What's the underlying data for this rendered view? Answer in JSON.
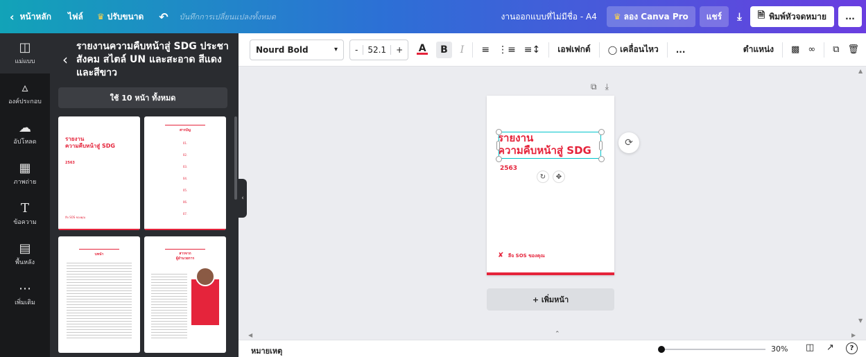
{
  "topbar": {
    "home_label": "หน้าหลัก",
    "file_label": "ไฟล์",
    "resize_label": "ปรับขนาด",
    "undo_icon": "undo-icon",
    "save_status": "บันทึกการเปลี่ยนแปลงทั้งหมด",
    "doc_title": "งานออกแบบที่ไม่มีชื่อ - A4",
    "pro_label": "ลอง Canva Pro",
    "share_label": "แชร์",
    "print_label": "พิมพ์หัวจดหมาย",
    "more_label": "..."
  },
  "rail": {
    "items": [
      {
        "label": "แม่แบบ",
        "icon": "template-icon"
      },
      {
        "label": "องค์ประกอบ",
        "icon": "elements-icon"
      },
      {
        "label": "อัปโหลด",
        "icon": "upload-icon"
      },
      {
        "label": "ภาพถ่าย",
        "icon": "photos-icon"
      },
      {
        "label": "ข้อความ",
        "icon": "text-icon"
      },
      {
        "label": "พื้นหลัง",
        "icon": "background-icon"
      },
      {
        "label": "เพิ่มเติม",
        "icon": "more-icon"
      }
    ]
  },
  "panel": {
    "title": "รายงานความคืบหน้าสู่ SDG ประชาสังคม สไตล์ UN และสะอาด สีแดงและสีขาว",
    "use_all_label": "ใช้ 10 หน้า ทั้งหมด",
    "thumb1": {
      "line1": "รายงาน",
      "line2": "ความคืบหน้าสู่ SDG",
      "year": "2563",
      "foot": "ลีจ SOS ของคุณ"
    },
    "thumb2": {
      "heading": "สารบัญ",
      "entries": [
        "01.",
        "02.",
        "03.",
        "04.",
        "05.",
        "06.",
        "07."
      ]
    },
    "thumb3": {
      "heading": "บทนำ"
    },
    "thumb4": {
      "heading": "สารจาก",
      "subheading": "ผู้อำนวยการ"
    }
  },
  "toolbar": {
    "font": "Nourd Bold",
    "size": "52.1",
    "minus": "-",
    "plus": "+",
    "color_label": "A",
    "bold_label": "B",
    "italic_label": "I",
    "effects_label": "เอฟเฟกต์",
    "animate_label": "เคลื่อนไหว",
    "more_label": "...",
    "position_label": "ตำแหน่ง"
  },
  "canvas": {
    "title_line1": "รายงาน",
    "title_line2": "ความคืบหน้าสู่ SDG",
    "year": "2563",
    "footer": "ลีจ SOS ของคุณ",
    "add_page_label": "+ เพิ่มหน้า"
  },
  "bottombar": {
    "notes_label": "หมายเหตุ",
    "zoom": "30%",
    "help_label": "?"
  },
  "colors": {
    "accent_red": "#e5243b",
    "selection": "#00c4cc"
  }
}
